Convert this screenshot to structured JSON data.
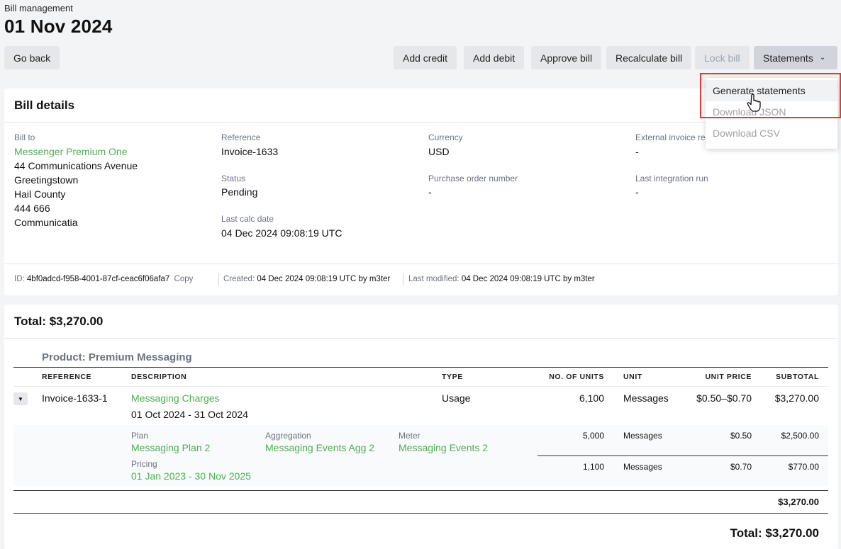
{
  "header": {
    "breadcrumb": "Bill management",
    "title": "01 Nov 2024",
    "go_back": "Go back",
    "add_credit": "Add credit",
    "add_debit": "Add debit",
    "approve_bill": "Approve bill",
    "recalculate_bill": "Recalculate bill",
    "lock_bill": "Lock bill",
    "statements": "Statements"
  },
  "statements_menu": {
    "items": [
      "Generate statements",
      "Download JSON",
      "Download CSV"
    ]
  },
  "bill_details": {
    "title": "Bill details",
    "bill_to_label": "Bill to",
    "bill_to_name": "Messenger Premium One",
    "address": [
      "44 Communications Avenue",
      "Greetingstown",
      "Hail County",
      "444 666",
      "Communicatia"
    ],
    "reference_label": "Reference",
    "reference": "Invoice-1633",
    "status_label": "Status",
    "status": "Pending",
    "last_calc_label": "Last calc date",
    "last_calc": "04 Dec 2024 09:08:19 UTC",
    "currency_label": "Currency",
    "currency": "USD",
    "po_label": "Purchase order number",
    "po": "-",
    "ext_invoice_label": "External invoice re",
    "ext_invoice": "-",
    "integration_label": "Last integration run",
    "integration": "-",
    "meta": {
      "id_label": "ID:",
      "id": "4bf0adcd-f958-4001-87cf-ceac6f06afa7",
      "copy": "Copy",
      "created_label": "Created:",
      "created": "04 Dec 2024 09:08:19 UTC by m3ter",
      "modified_label": "Last modified:",
      "modified": "04 Dec 2024 09:08:19 UTC by m3ter"
    }
  },
  "totals": {
    "title": "Total: $3,270.00",
    "product": "Product: Premium Messaging",
    "columns": [
      "REFERENCE",
      "DESCRIPTION",
      "TYPE",
      "NO. OF UNITS",
      "UNIT",
      "UNIT PRICE",
      "SUBTOTAL"
    ],
    "row": {
      "reference": "Invoice-1633-1",
      "description": "Messaging Charges",
      "period": "01 Oct 2024 - 31 Oct 2024",
      "type": "Usage",
      "units": "6,100",
      "unit": "Messages",
      "unit_price": "$0.50–$0.70",
      "subtotal": "$3,270.00"
    },
    "detail": {
      "plan_label": "Plan",
      "plan": "Messaging Plan 2",
      "aggregation_label": "Aggregation",
      "aggregation": "Messaging Events Agg 2",
      "meter_label": "Meter",
      "meter": "Messaging Events 2",
      "pricing_label": "Pricing",
      "pricing": "01 Jan 2023 - 30 Nov 2025",
      "tiers": [
        {
          "units": "5,000",
          "unit": "Messages",
          "price": "$0.50",
          "subtotal": "$2,500.00"
        },
        {
          "units": "1,100",
          "unit": "Messages",
          "price": "$0.70",
          "subtotal": "$770.00"
        }
      ]
    },
    "product_total": "$3,270.00",
    "grand_total": "Total: $3,270.00"
  }
}
